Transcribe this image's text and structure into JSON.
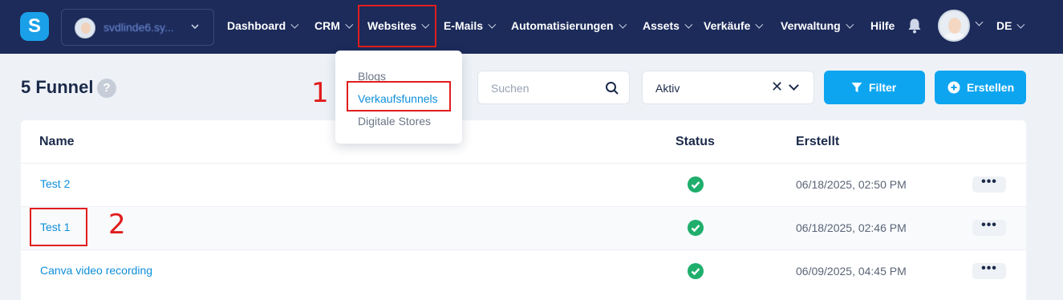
{
  "topbar": {
    "logo_letter": "S",
    "account_name": "svdlinde6.sy...",
    "nav": [
      {
        "label": "Dashboard"
      },
      {
        "label": "CRM"
      },
      {
        "label": "Websites"
      },
      {
        "label": "E-Mails"
      },
      {
        "label": "Automatisierungen"
      },
      {
        "label": "Assets"
      },
      {
        "label": "Verkäufe"
      },
      {
        "label": "Verwaltung"
      },
      {
        "label": "Hilfe"
      }
    ],
    "language": "DE"
  },
  "websites_menu": {
    "items": [
      {
        "label": "Blogs",
        "active": false
      },
      {
        "label": "Verkaufsfunnels",
        "active": true
      },
      {
        "label": "Digitale Stores",
        "active": false
      }
    ]
  },
  "page": {
    "title": "5 Funnel",
    "help": "?",
    "search_placeholder": "Suchen",
    "status_filter_value": "Aktiv",
    "filter_button": "Filter",
    "create_button": "Erstellen"
  },
  "annotations": {
    "step1": "1",
    "step2": "2"
  },
  "table": {
    "headers": {
      "name": "Name",
      "status": "Status",
      "created": "Erstellt"
    },
    "rows": [
      {
        "name": "Test 2",
        "status": "active",
        "created": "06/18/2025, 02:50 PM",
        "menu": "•••"
      },
      {
        "name": "Test 1",
        "status": "active",
        "created": "06/18/2025, 02:46 PM",
        "menu": "•••"
      },
      {
        "name": "Canva video recording",
        "status": "active",
        "created": "06/09/2025, 04:45 PM",
        "menu": "•••"
      }
    ]
  },
  "colors": {
    "nav_bg": "#1c2b5a",
    "accent": "#0ea5f0",
    "link": "#0e8ed9",
    "success": "#1fae6b",
    "annotation": "#e11d1d"
  }
}
